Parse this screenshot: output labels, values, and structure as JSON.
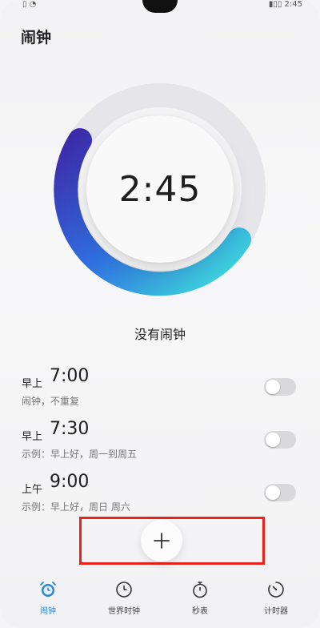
{
  "status": {
    "left": "▯ ◔",
    "right": "▮▯▯ 2:45"
  },
  "header": {
    "title": "闹钟"
  },
  "clock": {
    "time": "2:45"
  },
  "empty_state": "没有闹钟",
  "alarms": [
    {
      "period": "早上",
      "time": "7:00",
      "desc": "闹钟，不重复",
      "enabled": false
    },
    {
      "period": "早上",
      "time": "7:30",
      "desc": "示例：早上好，周一到周五",
      "enabled": false
    },
    {
      "period": "上午",
      "time": "9:00",
      "desc": "示例：早上好，周日 周六",
      "enabled": false
    }
  ],
  "add_button": {
    "symbol": "+"
  },
  "nav": [
    {
      "label": "闹钟",
      "icon": "alarm-clock-icon",
      "active": true
    },
    {
      "label": "世界时钟",
      "icon": "clock-icon",
      "active": false
    },
    {
      "label": "秒表",
      "icon": "stopwatch-icon",
      "active": false
    },
    {
      "label": "计时器",
      "icon": "timer-icon",
      "active": false
    }
  ],
  "colors": {
    "accent": "#2a86d8",
    "ring_start": "#3d2aa8",
    "ring_mid": "#2f6fe0",
    "ring_end": "#3fe0da",
    "highlight": "#e8231d"
  }
}
